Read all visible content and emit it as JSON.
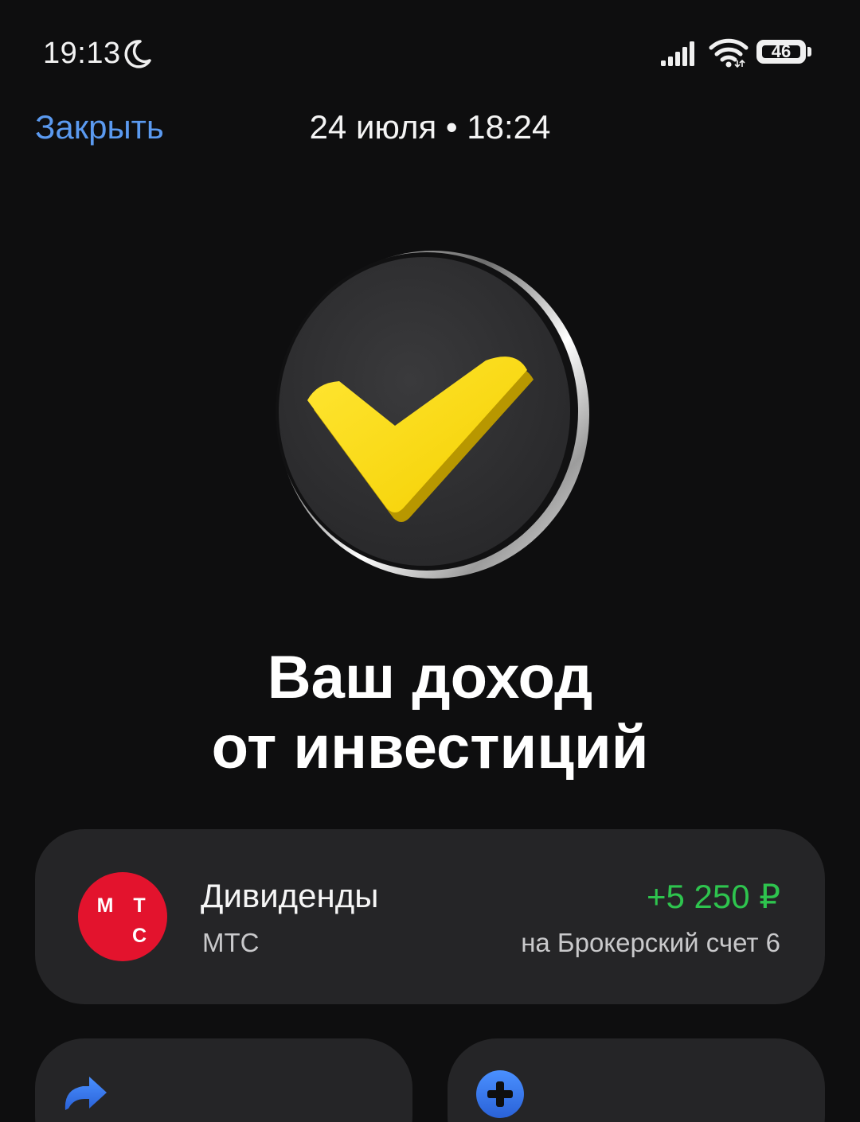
{
  "status_bar": {
    "time": "19:13",
    "battery_level": "46",
    "icons": [
      "moon-icon",
      "signal-icon",
      "wifi-icon",
      "battery-icon"
    ]
  },
  "header": {
    "close_label": "Закрыть",
    "datetime": "24 июля • 18:24"
  },
  "hero": {
    "icon": "checkmark-badge-icon",
    "checkmark_color": "#ffdd2d"
  },
  "title": {
    "line1": "Ваш доход",
    "line2": "от инвестиций"
  },
  "operation": {
    "avatar_letters": [
      "М",
      "Т",
      "С"
    ],
    "avatar_color": "#e3132d",
    "title": "Дивиденды",
    "subtitle": "МТС",
    "amount": "+5 250 ₽",
    "amount_color": "#2ec44e",
    "account": "на Брокерский счет 6"
  },
  "actions": [
    {
      "icon": "share-icon",
      "color": "#3b82f6"
    },
    {
      "icon": "plus-circle-icon",
      "color": "#3b82f6"
    }
  ],
  "colors": {
    "background": "#0e0e0f",
    "card": "#252527",
    "link": "#5b9af0"
  }
}
